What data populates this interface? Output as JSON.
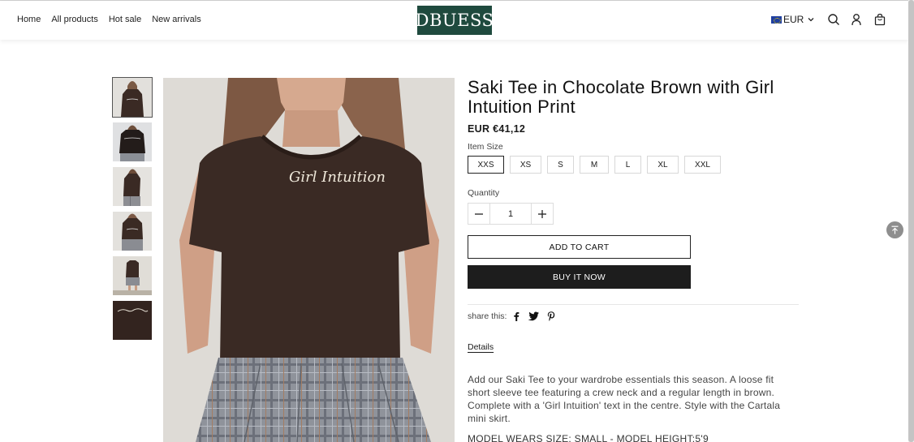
{
  "nav": [
    "Home",
    "All products",
    "Hot sale",
    "New arrivals"
  ],
  "brand": {
    "logo_text": "DBUESS",
    "logo_color": "#1f4a3e"
  },
  "currency": {
    "code": "EUR"
  },
  "header_icons": [
    "search-icon",
    "account-icon",
    "cart-bag-icon"
  ],
  "gallery": {
    "thumbnails": [
      "front-view",
      "back-view",
      "side-view",
      "front-closeup",
      "full-outfit",
      "print-detail"
    ],
    "active_index": 0
  },
  "product": {
    "title": "Saki Tee in Chocolate Brown with Girl Intuition Print",
    "price": "EUR €41,12",
    "print_text": "Girl Intuition",
    "size_label": "Item Size",
    "sizes": [
      "XXS",
      "XS",
      "S",
      "M",
      "L",
      "XL",
      "XXL"
    ],
    "selected_size": "XXS",
    "quantity_label": "Quantity",
    "quantity": "1",
    "add_to_cart": "ADD TO CART",
    "buy_now": "BUY IT NOW",
    "share_label": "share this:",
    "share_icons": [
      "facebook-icon",
      "twitter-icon",
      "pinterest-icon"
    ],
    "details_label": "Details",
    "description": "Add our Saki Tee to your wardrobe essentials this season. A loose fit short sleeve tee featuring a crew neck and a regular length in brown. Complete with a 'Girl Intuition' text in the centre. Style with the Cartala mini skirt.",
    "model_info": "MODEL WEARS SIZE: SMALL - MODEL HEIGHT:5'9"
  },
  "colors": {
    "shirt": "#3a2a24",
    "accent_dark": "#1d1d1d"
  }
}
